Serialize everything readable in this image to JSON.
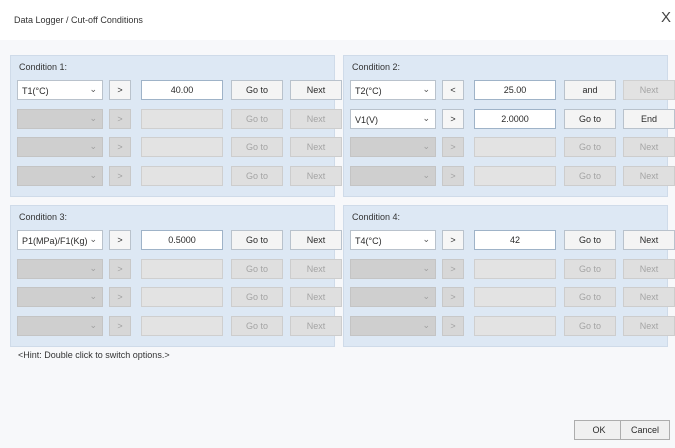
{
  "window": {
    "title": "Data Logger / Cut-off Conditions",
    "close_glyph": "X"
  },
  "conditions": [
    {
      "title": "Condition 1:",
      "rows": [
        {
          "select": "T1(°C)",
          "op": ">",
          "value": "40.00",
          "goto": "Go to",
          "next": "Next"
        },
        {
          "select": "",
          "op": ">",
          "value": "",
          "goto": "Go to",
          "next": "Next"
        },
        {
          "select": "",
          "op": ">",
          "value": "",
          "goto": "Go to",
          "next": "Next"
        },
        {
          "select": "",
          "op": ">",
          "value": "",
          "goto": "Go to",
          "next": "Next"
        }
      ]
    },
    {
      "title": "Condition 2:",
      "rows": [
        {
          "select": "T2(°C)",
          "op": "<",
          "value": "25.00",
          "goto": "and",
          "next": "Next"
        },
        {
          "select": "V1(V)",
          "op": ">",
          "value": "2.0000",
          "goto": "Go to",
          "next": "End"
        },
        {
          "select": "",
          "op": ">",
          "value": "",
          "goto": "Go to",
          "next": "Next"
        },
        {
          "select": "",
          "op": ">",
          "value": "",
          "goto": "Go to",
          "next": "Next"
        }
      ]
    },
    {
      "title": "Condition 3:",
      "rows": [
        {
          "select": "P1(MPa)/F1(Kg)",
          "op": ">",
          "value": "0.5000",
          "goto": "Go to",
          "next": "Next"
        },
        {
          "select": "",
          "op": ">",
          "value": "",
          "goto": "Go to",
          "next": "Next"
        },
        {
          "select": "",
          "op": ">",
          "value": "",
          "goto": "Go to",
          "next": "Next"
        },
        {
          "select": "",
          "op": ">",
          "value": "",
          "goto": "Go to",
          "next": "Next"
        }
      ]
    },
    {
      "title": "Condition 4:",
      "rows": [
        {
          "select": "T4(°C)",
          "op": ">",
          "value": "42",
          "goto": "Go to",
          "next": "Next"
        },
        {
          "select": "",
          "op": ">",
          "value": "",
          "goto": "Go to",
          "next": "Next"
        },
        {
          "select": "",
          "op": ">",
          "value": "",
          "goto": "Go to",
          "next": "Next"
        },
        {
          "select": "",
          "op": ">",
          "value": "",
          "goto": "Go to",
          "next": "Next"
        }
      ]
    }
  ],
  "hint": "<Hint: Double click to switch options.>",
  "buttons": {
    "ok": "OK",
    "cancel": "Cancel"
  }
}
